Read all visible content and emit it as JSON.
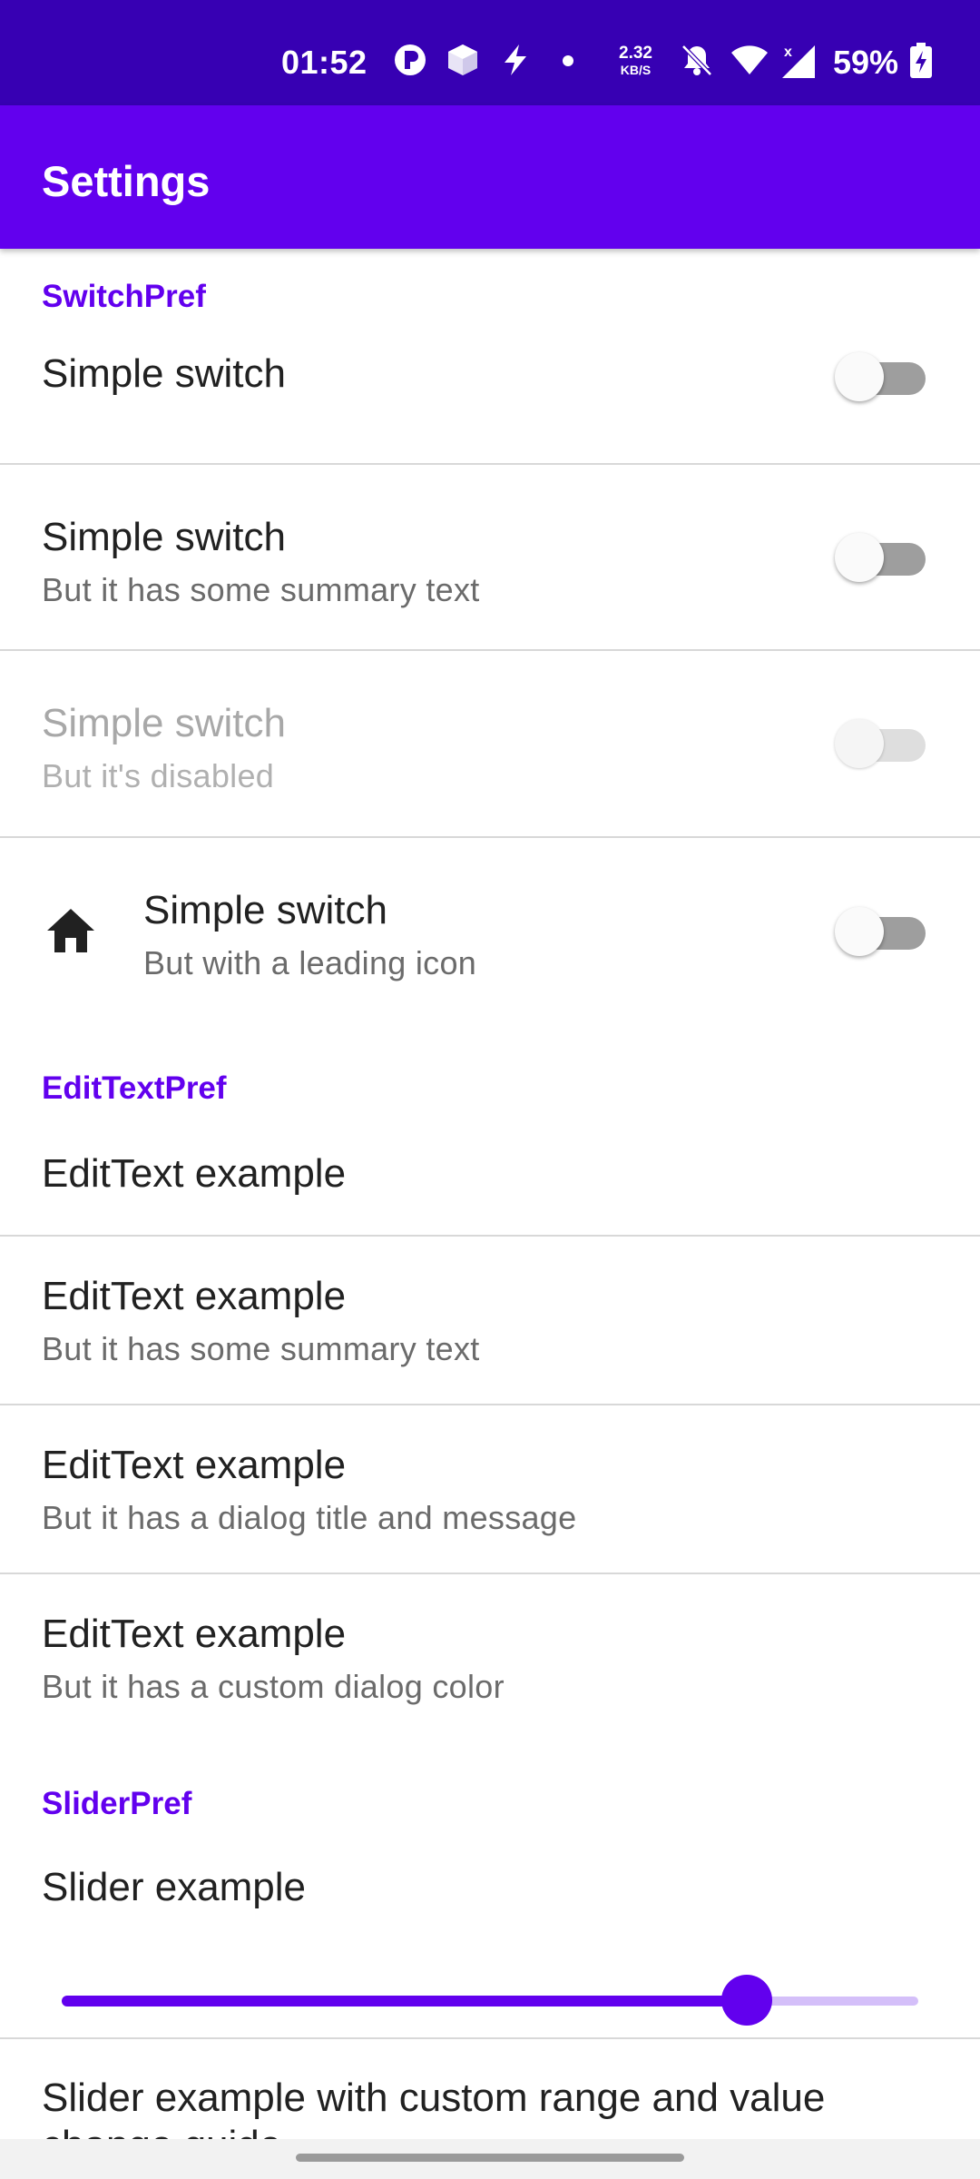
{
  "status_bar": {
    "time": "01:52",
    "net_speed_value": "2.32",
    "net_speed_unit": "KB/S",
    "battery_percent": "59%",
    "icons": [
      "app-badge-icon",
      "cube-icon",
      "bolt-icon",
      "dot-icon",
      "bell-off-icon",
      "wifi-icon",
      "signal-icon",
      "battery-charging-icon"
    ]
  },
  "app_bar": {
    "title": "Settings"
  },
  "sections": {
    "switch": {
      "header": "SwitchPref",
      "items": [
        {
          "title": "Simple switch",
          "summary": "",
          "checked": false,
          "enabled": true
        },
        {
          "title": "Simple switch",
          "summary": "But it has some summary text",
          "checked": false,
          "enabled": true
        },
        {
          "title": "Simple switch",
          "summary": "But it's disabled",
          "checked": false,
          "enabled": false
        },
        {
          "title": "Simple switch",
          "summary": "But with a leading icon",
          "checked": false,
          "enabled": true,
          "icon": "home-icon"
        }
      ]
    },
    "edittext": {
      "header": "EditTextPref",
      "items": [
        {
          "title": "EditText example",
          "summary": ""
        },
        {
          "title": "EditText example",
          "summary": "But it has some summary text"
        },
        {
          "title": "EditText example",
          "summary": "But it has a dialog title and message"
        },
        {
          "title": "EditText example",
          "summary": "But it has a custom dialog color"
        }
      ]
    },
    "slider": {
      "header": "SliderPref",
      "items": [
        {
          "title": "Slider example",
          "value_fraction": 0.8
        },
        {
          "title": "Slider example with custom range and value",
          "summary": "change guide"
        }
      ]
    }
  },
  "colors": {
    "status_bar": "#3700b3",
    "primary": "#6200ee",
    "slider_inactive": "#d4bff9"
  }
}
